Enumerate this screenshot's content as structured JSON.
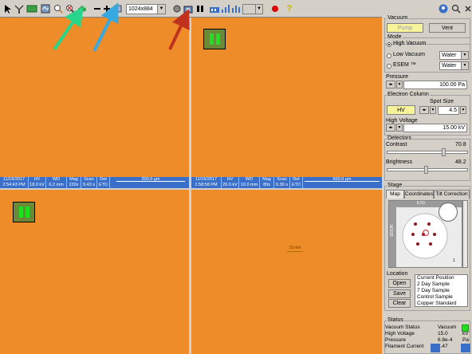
{
  "toolbar": {
    "resolution": "1024x884",
    "help_label": "?",
    "tools": [
      "cursor",
      "magnifier",
      "tool",
      "screen",
      "magnify-plus",
      "magnify-x",
      "camera",
      "zoom-out",
      "zoom-in",
      "move",
      "pause",
      "bar-chart",
      "bar-chart2",
      "stop",
      "help"
    ]
  },
  "quad_tl": {
    "databar": {
      "date": "11/16/2017",
      "time": "2:54:43 PM",
      "hv_label": "HV",
      "hv": "18.0 kV",
      "wd_label": "WD",
      "wd": "6.2 mm",
      "mag_label": "Mag",
      "mag": "220x",
      "scan_label": "Scan",
      "scan": "9.43 s",
      "det_label": "Det",
      "det": "ETD",
      "scale": "200.0 µm"
    }
  },
  "quad_tr": {
    "databar": {
      "date": "11/16/2017",
      "time": "1:58:58 PM",
      "hv_label": "HV",
      "hv": "20.0 kV",
      "wd_label": "WD",
      "wd": "10.0 mm",
      "mag_label": "Mag",
      "mag": "80x",
      "scan_label": "Scan",
      "scan": "0.30 s",
      "det_label": "Det",
      "det": "ETD",
      "scale": "500.0 µm"
    }
  },
  "quad_br": {
    "scale": "10 mm"
  },
  "panel": {
    "vacuum": {
      "title": "Vacuum",
      "pump_label": "Pump",
      "vent_label": "Vent"
    },
    "mode": {
      "title": "Mode",
      "high_vacuum": "High Vacuum",
      "low_vacuum": "Low Vacuum",
      "esem": "ESEM ™",
      "low_vacuum_gas": "Water",
      "esem_gas": "Water"
    },
    "pressure": {
      "title": "Pressure",
      "value": "100.00 Pa"
    },
    "electron_column": {
      "title": "Electron Column",
      "hv_label": "HV",
      "spot_size_label": "Spot Size",
      "spot_size": "4.5",
      "high_voltage_label": "High Voltage",
      "high_voltage": "15.00 kV"
    },
    "detectors": {
      "title": "Detectors",
      "contrast_label": "Contrast",
      "contrast": "70.8",
      "contrast_level": 0.708,
      "brightness_label": "Brightness",
      "brightness": "48.2",
      "brightness_level": 0.482
    },
    "stage": {
      "title": "Stage",
      "tabs": [
        "Map",
        "Coordinates",
        "Tilt Correction"
      ],
      "map_etd_label": "ETD",
      "map_door_label": "DOOR",
      "map_scale_label": "1"
    },
    "location": {
      "title": "Location",
      "open_label": "Open",
      "save_label": "Save",
      "clear_label": "Clear",
      "items": [
        "Current Position",
        "2 Day Sample",
        "7 Day Sample",
        "Control Sample",
        "Copper Standard"
      ]
    },
    "status": {
      "title": "Status",
      "rows": [
        {
          "label": "Vacuum Status",
          "value": "Vacuum",
          "unit": ""
        },
        {
          "label": "High Voltage",
          "value": "15.0",
          "unit": "kV"
        },
        {
          "label": "Pressure",
          "value": "6.8e-4",
          "unit": "Pa"
        },
        {
          "label": "Filament Current",
          "value": "2.47",
          "unit": "A"
        }
      ]
    }
  },
  "colors": {
    "image_bg": "#ef8c2a",
    "databar": "#3a6fc9",
    "pause_green": "#1fe01f",
    "arrow_green": "#27d68a",
    "arrow_blue": "#35a9e0",
    "arrow_red": "#c0321e",
    "status_green": "#22dd22"
  }
}
